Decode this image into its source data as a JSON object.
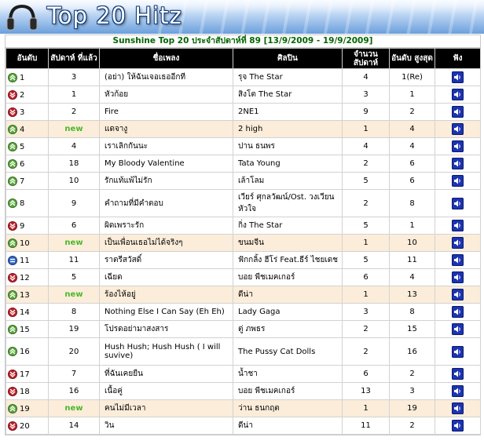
{
  "header": {
    "title": "Top 20 Hitz"
  },
  "chart_caption": "Sunshine Top 20 ประจำสัปดาห์ที่ 89 [13/9/2009 - 19/9/2009]",
  "columns": [
    "อันดับ",
    "สัปดาห์ ที่แล้ว",
    "ชื่อเพลง",
    "ศิลปิน",
    "จำนวน สัปดาห์",
    "อันดับ สูงสุด",
    "ฟัง"
  ],
  "colors": {
    "up": "#5aa83a",
    "down": "#c0202a",
    "same": "#2f63c4",
    "new": "#4ab82a",
    "caption": "#006600",
    "highlight": "#fbedda"
  },
  "rows": [
    {
      "rank": "1",
      "trend": "up",
      "last": "3",
      "song": "(อย่า) ให้ฉันเจอเธออีกที",
      "artist": "รุจ The Star",
      "weeks": "4",
      "peak": "1(Re)"
    },
    {
      "rank": "2",
      "trend": "down",
      "last": "1",
      "song": "หัวก้อย",
      "artist": "สิงโต The Star",
      "weeks": "3",
      "peak": "1"
    },
    {
      "rank": "3",
      "trend": "down",
      "last": "2",
      "song": "Fire",
      "artist": "2NE1",
      "weeks": "9",
      "peak": "2"
    },
    {
      "rank": "4",
      "trend": "up",
      "last": "new",
      "song": "แดจางู",
      "artist": "2 high",
      "weeks": "1",
      "peak": "4"
    },
    {
      "rank": "5",
      "trend": "up",
      "last": "4",
      "song": "เราเลิกกันนะ",
      "artist": "ปาน ธนพร",
      "weeks": "4",
      "peak": "4"
    },
    {
      "rank": "6",
      "trend": "up",
      "last": "18",
      "song": "My Bloody Valentine",
      "artist": "Tata Young",
      "weeks": "2",
      "peak": "6"
    },
    {
      "rank": "7",
      "trend": "up",
      "last": "10",
      "song": "รักแท้แพ้ไม่รัก",
      "artist": "เล้าโลม",
      "weeks": "5",
      "peak": "6"
    },
    {
      "rank": "8",
      "trend": "up",
      "last": "9",
      "song": "คำถามที่มีคำตอบ",
      "artist": "เวียร์ ศุกลวัฒน์/Ost. วงเวียนหัวใจ",
      "weeks": "2",
      "peak": "8",
      "tall": true
    },
    {
      "rank": "9",
      "trend": "down",
      "last": "6",
      "song": "ผิดเพราะรัก",
      "artist": "กิ่ง The Star",
      "weeks": "5",
      "peak": "1"
    },
    {
      "rank": "10",
      "trend": "up",
      "last": "new",
      "song": "เป็นเพื่อนเธอไม่ได้จริงๆ",
      "artist": "ขนมจีน",
      "weeks": "1",
      "peak": "10"
    },
    {
      "rank": "11",
      "trend": "same",
      "last": "11",
      "song": "ราตรีสวัสดิ์",
      "artist": "ฟักกลิ้ง ฮีโร่ Feat.ธีร์ ไชยเดช",
      "weeks": "5",
      "peak": "11"
    },
    {
      "rank": "12",
      "trend": "down",
      "last": "5",
      "song": "เฉียด",
      "artist": "บอย พีชเมคเกอร์",
      "weeks": "6",
      "peak": "4"
    },
    {
      "rank": "13",
      "trend": "up",
      "last": "new",
      "song": "ร้องไห้อยู่",
      "artist": "ดีน่า",
      "weeks": "1",
      "peak": "13"
    },
    {
      "rank": "14",
      "trend": "down",
      "last": "8",
      "song": "Nothing Else I Can Say (Eh Eh)",
      "artist": "Lady Gaga",
      "weeks": "3",
      "peak": "8"
    },
    {
      "rank": "15",
      "trend": "up",
      "last": "19",
      "song": "โปรดอย่ามาสงสาร",
      "artist": "ตู่ ภพธร",
      "weeks": "2",
      "peak": "15"
    },
    {
      "rank": "16",
      "trend": "up",
      "last": "20",
      "song": "Hush Hush; Hush Hush ( I will suvive)",
      "artist": "The Pussy Cat Dolls",
      "weeks": "2",
      "peak": "16",
      "tall": true
    },
    {
      "rank": "17",
      "trend": "down",
      "last": "7",
      "song": "ที่ฉันเคยยืน",
      "artist": "น้ำชา",
      "weeks": "6",
      "peak": "2"
    },
    {
      "rank": "18",
      "trend": "down",
      "last": "16",
      "song": "เนื้อคู่",
      "artist": "บอย พีชเมคเกอร์",
      "weeks": "13",
      "peak": "3"
    },
    {
      "rank": "19",
      "trend": "up",
      "last": "new",
      "song": "คนไม่มีเวลา",
      "artist": "ว่าน ธนกฤต",
      "weeks": "1",
      "peak": "19"
    },
    {
      "rank": "20",
      "trend": "down",
      "last": "14",
      "song": "วิน",
      "artist": "ดีน่า",
      "weeks": "11",
      "peak": "2"
    }
  ]
}
